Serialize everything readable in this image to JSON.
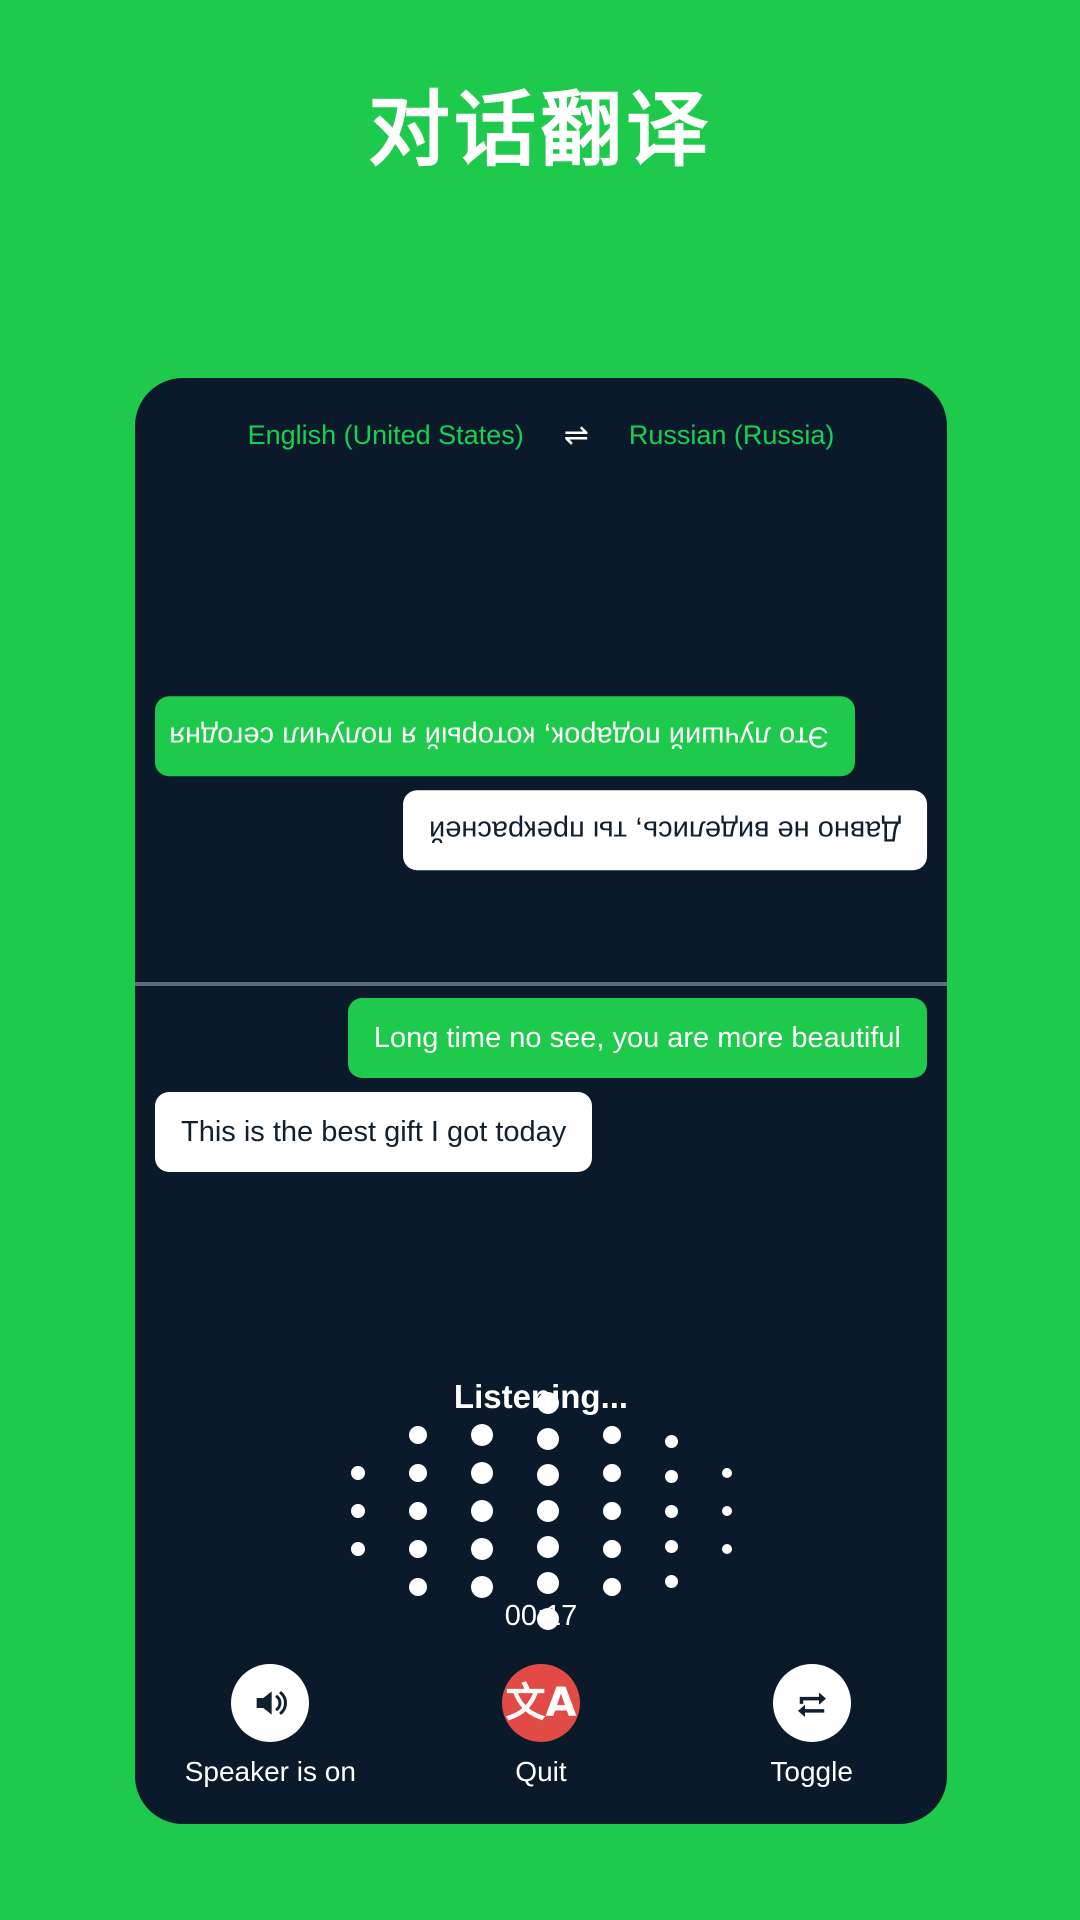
{
  "page": {
    "title": "对话翻译",
    "background_color": "#1ECA4B"
  },
  "card": {
    "background_color": "#0B1A2B"
  },
  "language_bar": {
    "source_language": "English (United States)",
    "target_language": "Russian (Russia)",
    "swap_icon": "swap-horizontal-icon",
    "swap_glyph": "⇌",
    "text_color": "#17D154"
  },
  "conversation": {
    "top_pane_rotated": true,
    "top_messages": [
      {
        "text": "Это лучший подарок, который я получил сегодня",
        "style": "green",
        "align": "left",
        "rotated": true
      },
      {
        "text": "Давно не виделись, ты прекрасней",
        "style": "white",
        "align": "right",
        "rotated": true
      }
    ],
    "bottom_messages": [
      {
        "text": "Long time no see, you are more beautiful",
        "style": "green",
        "align": "right",
        "rotated": false
      },
      {
        "text": "This is the best gift I got today",
        "style": "white",
        "align": "left",
        "rotated": false
      }
    ]
  },
  "status": {
    "listening_label": "Listening...",
    "timer": "00:17"
  },
  "waveform": {
    "columns": [
      {
        "dots": 3,
        "size": 14,
        "gap": 24
      },
      {
        "dots": 5,
        "size": 18,
        "gap": 20
      },
      {
        "dots": 5,
        "size": 22,
        "gap": 16
      },
      {
        "dots": 7,
        "size": 22,
        "gap": 14
      },
      {
        "dots": 5,
        "size": 18,
        "gap": 20
      },
      {
        "dots": 5,
        "size": 13,
        "gap": 22
      },
      {
        "dots": 3,
        "size": 10,
        "gap": 28
      }
    ],
    "dot_color": "#ffffff"
  },
  "controls": [
    {
      "label": "Speaker is on",
      "icon": "speaker-on-icon",
      "circle_color": "#ffffff",
      "icon_color": "#11202E"
    },
    {
      "label": "Quit",
      "icon": "translate-icon",
      "glyph": "文A",
      "circle_color": "#E24B45",
      "icon_color": "#ffffff"
    },
    {
      "label": "Toggle",
      "icon": "repeat-icon",
      "circle_color": "#ffffff",
      "icon_color": "#11202E"
    }
  ]
}
